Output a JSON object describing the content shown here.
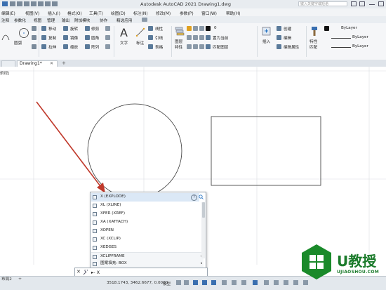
{
  "window": {
    "title": "Autodesk AutoCAD 2021    Drawing1.dwg",
    "search_placeholder": "键入关键字或短语"
  },
  "menubar": [
    "编辑(E)",
    "视图(V)",
    "插入(I)",
    "格式(O)",
    "工具(T)",
    "绘图(D)",
    "标注(N)",
    "修改(M)",
    "参数(P)",
    "窗口(W)",
    "帮助(H)"
  ],
  "ribbon_tabs": [
    "注释",
    "参数化",
    "视图",
    "管理",
    "输出",
    "附加模块",
    "协作",
    "精选应用"
  ],
  "ribbon": {
    "modify": {
      "move": "移动",
      "rotate": "旋转",
      "trim": "修剪",
      "copy": "复制",
      "mirror": "镜像",
      "fillet": "圆角",
      "stretch": "拉伸",
      "scale": "缩放",
      "array": "阵列"
    },
    "draw": {
      "circle": "圆弧"
    },
    "annotation": {
      "text": "文字",
      "dimension": "标注",
      "linear": "线性",
      "leader": "引线",
      "table": "表格"
    },
    "layers": {
      "layer_props": "图层",
      "layer_props2": "特性",
      "current_layer": "0",
      "make_current": "置为当前",
      "match_layer": "匹配图层"
    },
    "block": {
      "insert": "插入",
      "create": "创建",
      "edit": "编辑",
      "edit_attr": "编辑属性"
    },
    "properties": {
      "match": "特性",
      "match2": "匹配",
      "color": "ByLayer",
      "linetype": "ByLayer",
      "lineweight": "ByLayer"
    }
  },
  "doc_tabs": {
    "active": "Drawing1*",
    "add": "+"
  },
  "canvas": {
    "view_label": "俯视]"
  },
  "autocomplete": {
    "items": [
      {
        "label": "X (EXPLODE)",
        "selected": true
      },
      {
        "label": "XL (XLINE)"
      },
      {
        "label": "XFER (XREF)"
      },
      {
        "label": "XA (XATTACH)"
      },
      {
        "label": "XOPEN"
      },
      {
        "label": "XC (XCLIP)"
      },
      {
        "label": "XEDGES"
      },
      {
        "label": "XCLIPFRAME",
        "has_submenu": true
      },
      {
        "label": "图案填充: BOX",
        "has_submenu": true
      }
    ],
    "help": "?"
  },
  "command_line": {
    "close": "✕",
    "prompt": "▸- X"
  },
  "statusbar": {
    "layout": "布局2",
    "coords": "3518.1743, 3462.6677, 0.0000",
    "model": "模型",
    "zoom": "1:1 / 100%"
  },
  "watermark": {
    "brand": "U教授",
    "url": "UJIAOSHOU.COM"
  },
  "colors": {
    "accent": "#1f6fc2",
    "arrow": "#c0392b",
    "brand": "#1a7a2a"
  }
}
